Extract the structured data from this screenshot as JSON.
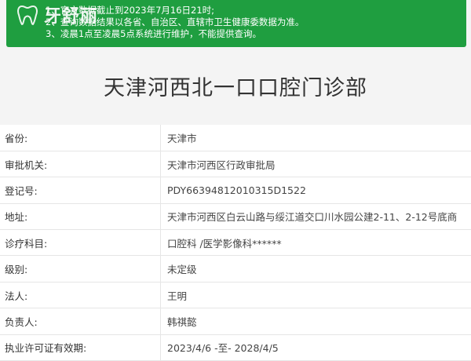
{
  "notice": {
    "lines": [
      "1、官方数据截止到2023年7月16日21时;",
      "2、查询数据结果以各省、自治区、直辖市卫生健康委数据为准。",
      "3、凌晨1点至凌晨5点系统进行维护，不能提供查询。"
    ],
    "background": "#1f9e40"
  },
  "logo": {
    "text": "牙舒丽",
    "icon": "tooth-logo-icon"
  },
  "page_title": "天津河西北一口口腔门诊部",
  "fields": [
    {
      "label": "省份:",
      "value": "天津市"
    },
    {
      "label": "审批机关:",
      "value": "天津市河西区行政审批局"
    },
    {
      "label": "登记号:",
      "value": "PDY66394812010315D1522"
    },
    {
      "label": "地址:",
      "value": "天津市河西区白云山路与绥江道交口川水园公建2-11、2-12号底商"
    },
    {
      "label": "诊疗科目:",
      "value": "口腔科 /医学影像科******"
    },
    {
      "label": "级别:",
      "value": "未定级"
    },
    {
      "label": "法人:",
      "value": "王明"
    },
    {
      "label": "负责人:",
      "value": "韩祺懿"
    },
    {
      "label": "执业许可证有效期:",
      "value": "2023/4/6 -至- 2028/4/5"
    }
  ]
}
